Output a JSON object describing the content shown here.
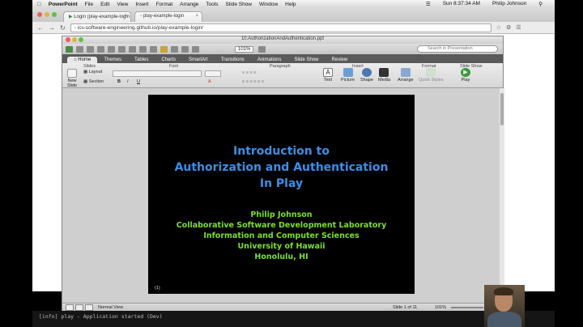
{
  "menubar": {
    "app": "PowerPoint",
    "items": [
      "File",
      "Edit",
      "View",
      "Insert",
      "Format",
      "Arrange",
      "Tools",
      "Slide Show",
      "Window",
      "Help"
    ],
    "clock": "Sun 8:37:34 AM",
    "user": "Philip Johnson"
  },
  "browser": {
    "tabs": [
      {
        "label": "Login (play-example-login"
      },
      {
        "label": "play-example-login"
      }
    ],
    "url": "ics-software-engineering.github.io/play-example-login/"
  },
  "ppt": {
    "title": "10.AuthorizationAndAuthentication.ppt",
    "zoom": "101%",
    "search_placeholder": "Search in Presentation",
    "ribbon_tabs": [
      "Home",
      "Themes",
      "Tables",
      "Charts",
      "SmartArt",
      "Transitions",
      "Animations",
      "Slide Show",
      "Review"
    ],
    "groups": {
      "slides": "Slides",
      "font": "Font",
      "paragraph": "Paragraph",
      "insert": "Insert",
      "format": "Format",
      "slideshow": "Slide Show"
    },
    "buttons": {
      "new_slide": "New Slide",
      "layout": "Layout",
      "section": "Section",
      "text": "Text",
      "picture": "Picture",
      "shape": "Shape",
      "media": "Media",
      "arrange": "Arrange",
      "quick_styles": "Quick Styles",
      "play": "Play"
    },
    "slide": {
      "title_line1": "Introduction to",
      "title_line2": "Authorization and Authentication",
      "title_line3": "In Play",
      "author": "Philip Johnson",
      "lab": "Collaborative Software Development Laboratory",
      "dept": "Information and Computer Sciences",
      "univ": "University of Hawaii",
      "city": "Honolulu, HI",
      "number": "(1)"
    },
    "status": {
      "view": "Normal View",
      "slide_of": "Slide 1 of 11",
      "zoom": "101%"
    }
  },
  "terminal": {
    "text": "[info] play - Application started (Dev)"
  },
  "colors": {
    "slide_title": "#3b8fe8",
    "slide_subtitle": "#7be02a",
    "slide_bg": "#000000"
  }
}
